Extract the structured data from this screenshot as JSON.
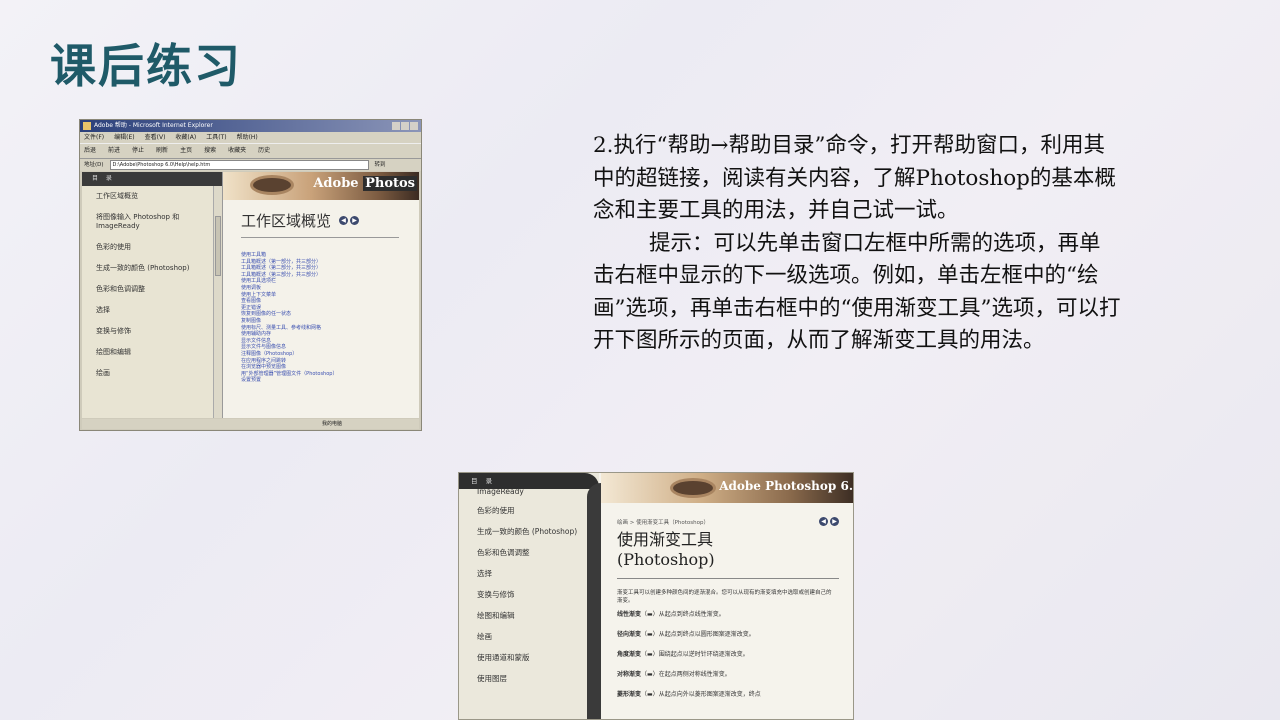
{
  "title": "课后练习",
  "paragraph1": "2.执行“帮助→帮助目录”命令，打开帮助窗口，利用其中的超链接，阅读有关内容，了解Photoshop的基本概念和主要工具的用法，并自己试一试。",
  "paragraph2": "提示：可以先单击窗口左框中所需的选项，再单击右框中显示的下一级选项。例如，单击左框中的“绘画”选项，再单击右框中的“使用渐变工具”选项，可以打开下图所示的页面，从而了解渐变工具的用法。",
  "shot1": {
    "window_title": "Adobe 帮助 - Microsoft Internet Explorer",
    "menu": [
      "文件(F)",
      "编辑(E)",
      "查看(V)",
      "收藏(A)",
      "工具(T)",
      "帮助(H)"
    ],
    "toolbar": [
      "后退",
      "前进",
      "停止",
      "刷新",
      "主页",
      "搜索",
      "收藏夹",
      "历史"
    ],
    "address_label": "地址(D)",
    "address_value": "D:\\Adobe\\Photoshop 6.0\\Help\\help.htm",
    "go_label": "转到",
    "left_head": "目 录",
    "left_items": [
      "工作区域概览",
      "将图像输入 Photoshop 和 ImageReady",
      "色彩的使用",
      "生成一致的颜色 (Photoshop)",
      "色彩和色调调整",
      "选择",
      "变换与修饰",
      "绘图和编辑",
      "绘画"
    ],
    "banner_logo_adobe": "Adobe",
    "banner_logo_ps": "Photos",
    "page_heading": "工作区域概览",
    "links": [
      "使用工具箱",
      "工具箱概述（第一部分，共三部分）",
      "工具箱概述（第二部分，共三部分）",
      "工具箱概述（第三部分，共三部分）",
      "使用工具选项栏",
      "使用调板",
      "使用上下文菜单",
      "查看图像",
      "更正错误",
      "恢复到图像的任一状态",
      "复制图像",
      "使用标尺、测量工具、参考线和网格",
      "使用辅助内存",
      "显示文件信息",
      "显示文件与图像信息",
      "注释图像（Photoshop）",
      "在应用程序之间跳转",
      "在浏览器中预览图像",
      "用“外部管理器”管理图文件（Photoshop）",
      "设置预置"
    ],
    "status": "我的电脑"
  },
  "shot2": {
    "left_head": "目 录",
    "left_items": [
      "ImageReady",
      "色彩的使用",
      "生成一致的颜色 (Photoshop)",
      "色彩和色调调整",
      "选择",
      "变换与修饰",
      "绘图和编辑",
      "绘画",
      "使用通道和蒙版",
      "使用图层"
    ],
    "banner_logo": "Adobe Photoshop 6.",
    "breadcrumb": "绘画 > 使用渐变工具（Photoshop）",
    "heading_line1": "使用渐变工具",
    "heading_line2": "(Photoshop)",
    "intro": "渐变工具可以创建多种颜色间的逐渐混合。您可以从现有的渐变填充中选取或创建自己的渐变。",
    "gradients": [
      {
        "name": "线性渐变",
        "desc": "从起点到终点线性渐变。"
      },
      {
        "name": "径向渐变",
        "desc": "从起点到终点以圆形图案逐渐改变。"
      },
      {
        "name": "角度渐变",
        "desc": "围绕起点以逆时针环绕逐渐改变。"
      },
      {
        "name": "对称渐变",
        "desc": "在起点两侧对称线性渐变。"
      },
      {
        "name": "菱形渐变",
        "desc": "从起点向外以菱形图案逐渐改变，终点"
      }
    ]
  }
}
